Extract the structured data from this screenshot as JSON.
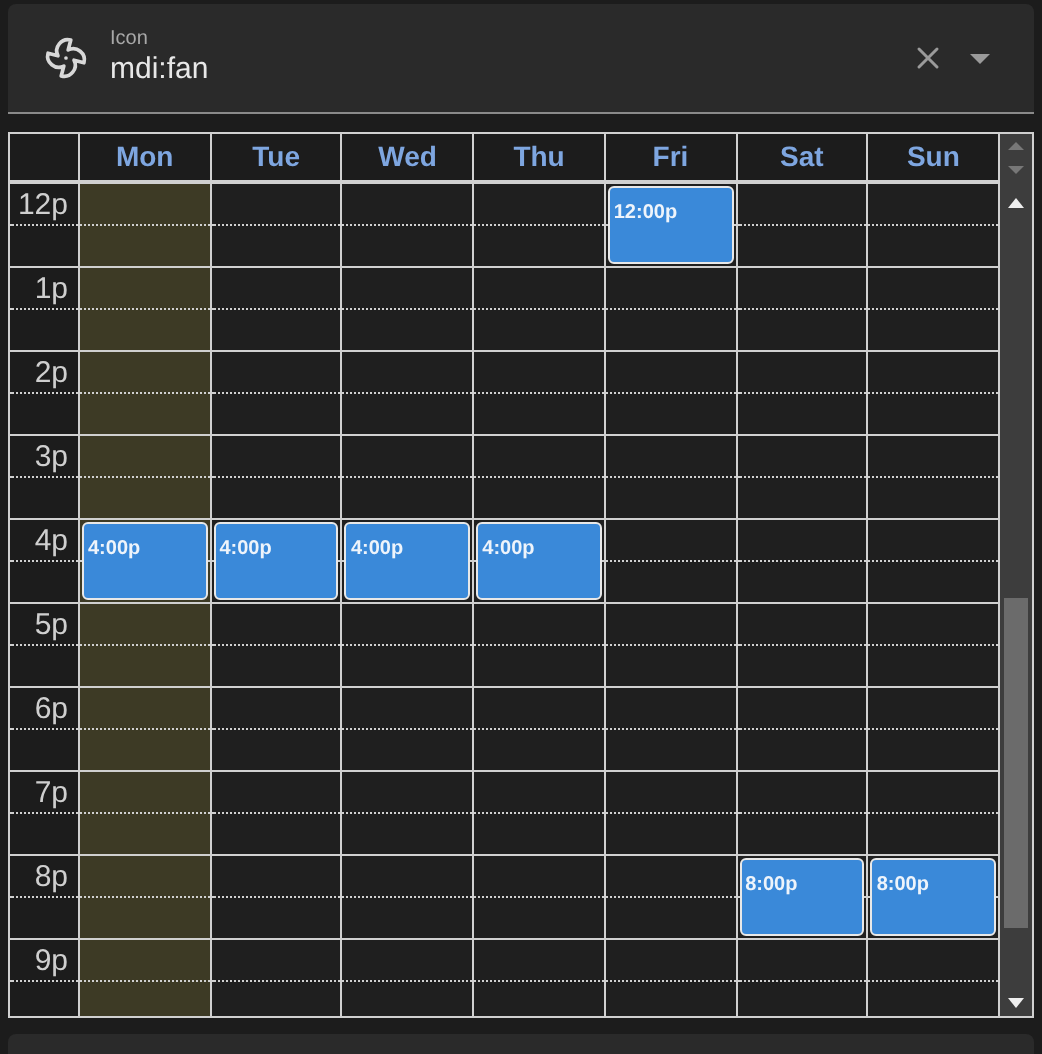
{
  "field": {
    "label": "Icon",
    "value": "mdi:fan"
  },
  "days": [
    {
      "label": "Mon",
      "today": true
    },
    {
      "label": "Tue",
      "today": false
    },
    {
      "label": "Wed",
      "today": false
    },
    {
      "label": "Thu",
      "today": false
    },
    {
      "label": "Fri",
      "today": false
    },
    {
      "label": "Sat",
      "today": false
    },
    {
      "label": "Sun",
      "today": false
    }
  ],
  "rows": [
    {
      "label": "12p",
      "cells": [
        {},
        {},
        {},
        {},
        {
          "event": "12:00p"
        },
        {},
        {}
      ]
    },
    {
      "label": "1p",
      "cells": [
        {},
        {},
        {},
        {},
        {},
        {},
        {}
      ]
    },
    {
      "label": "2p",
      "cells": [
        {},
        {},
        {},
        {},
        {},
        {},
        {}
      ]
    },
    {
      "label": "3p",
      "cells": [
        {},
        {},
        {},
        {},
        {},
        {},
        {}
      ]
    },
    {
      "label": "4p",
      "cells": [
        {
          "event": "4:00p"
        },
        {
          "event": "4:00p"
        },
        {
          "event": "4:00p"
        },
        {
          "event": "4:00p"
        },
        {},
        {},
        {}
      ]
    },
    {
      "label": "5p",
      "cells": [
        {},
        {},
        {},
        {},
        {},
        {},
        {}
      ]
    },
    {
      "label": "6p",
      "cells": [
        {},
        {},
        {},
        {},
        {},
        {},
        {}
      ]
    },
    {
      "label": "7p",
      "cells": [
        {},
        {},
        {},
        {},
        {},
        {},
        {}
      ]
    },
    {
      "label": "8p",
      "cells": [
        {},
        {},
        {},
        {},
        {},
        {
          "event": "8:00p"
        },
        {
          "event": "8:00p"
        }
      ]
    },
    {
      "label": "9p",
      "cells": [
        {},
        {},
        {},
        {},
        {},
        {},
        {}
      ]
    }
  ]
}
